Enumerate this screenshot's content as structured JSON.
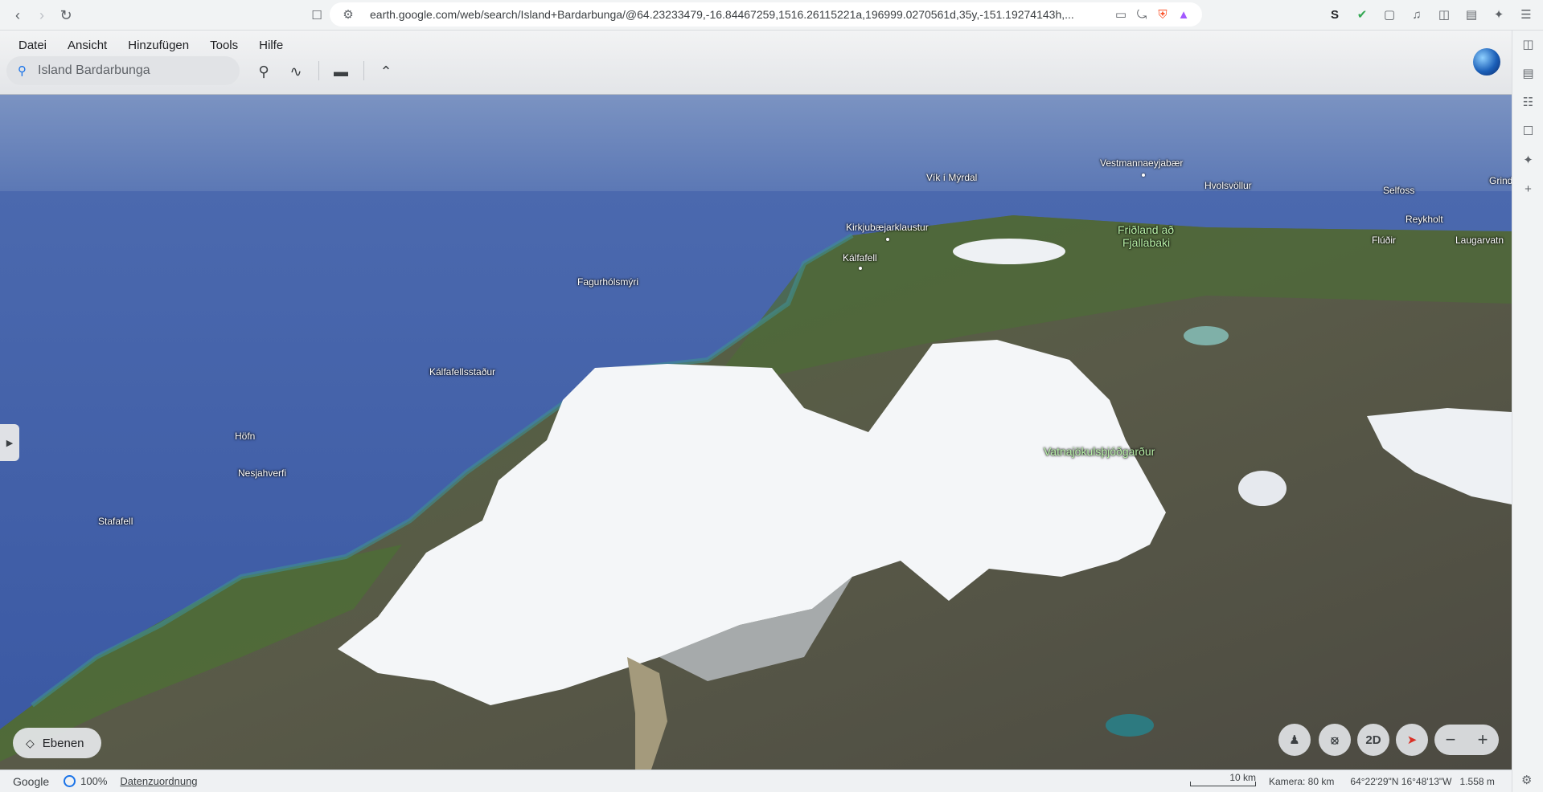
{
  "browser": {
    "url": "earth.google.com/web/search/Island+Bardarbunga/@64.23233479,-16.84467259,1516.26115221a,196999.0270561d,35y,-151.19274143h,...",
    "back_icon": "arrow-left-icon",
    "forward_icon": "arrow-right-icon",
    "reload_icon": "reload-icon"
  },
  "menu": {
    "items": [
      "Datei",
      "Ansicht",
      "Hinzufügen",
      "Tools",
      "Hilfe"
    ]
  },
  "search": {
    "value": "Island Bardarbunga"
  },
  "places": [
    {
      "label": "Vík í Mýrdal",
      "type": "town"
    },
    {
      "label": "Vestmannaeyjabær",
      "type": "town"
    },
    {
      "label": "Hvolsvöllur",
      "type": "town"
    },
    {
      "label": "Selfoss",
      "type": "town"
    },
    {
      "label": "Grind",
      "type": "town"
    },
    {
      "label": "Reykholt",
      "type": "town"
    },
    {
      "label": "Flúðir",
      "type": "town"
    },
    {
      "label": "Laugarvatn",
      "type": "town"
    },
    {
      "label": "Kirkjubæjarklaustur",
      "type": "town"
    },
    {
      "label": "Kálfafell",
      "type": "town"
    },
    {
      "label": "Friðland að",
      "type": "park"
    },
    {
      "label": "Fjallabaki",
      "type": "park"
    },
    {
      "label": "Fagurhólsmýri",
      "type": "town"
    },
    {
      "label": "Kálfafellsstaður",
      "type": "town"
    },
    {
      "label": "Höfn",
      "type": "town"
    },
    {
      "label": "Nesjahverfi",
      "type": "town"
    },
    {
      "label": "Stafafell",
      "type": "town"
    },
    {
      "label": "Vatnajökulsþjóðgarður",
      "type": "park"
    }
  ],
  "controls": {
    "layers_label": "Ebenen",
    "mode_2d": "2D",
    "zoom_out": "−",
    "zoom_in": "+"
  },
  "status": {
    "brand": "Google",
    "load_percent": "100%",
    "attribution": "Datenzuordnung",
    "scale": "10 km",
    "camera": "Kamera: 80 km",
    "coordinates": "64°22'29\"N 16°48'13\"W",
    "elevation": "1.558 m"
  },
  "colors": {
    "accent": "#1a73e8",
    "ocean": "#3e5da8",
    "glacier": "#f4f6f8"
  }
}
